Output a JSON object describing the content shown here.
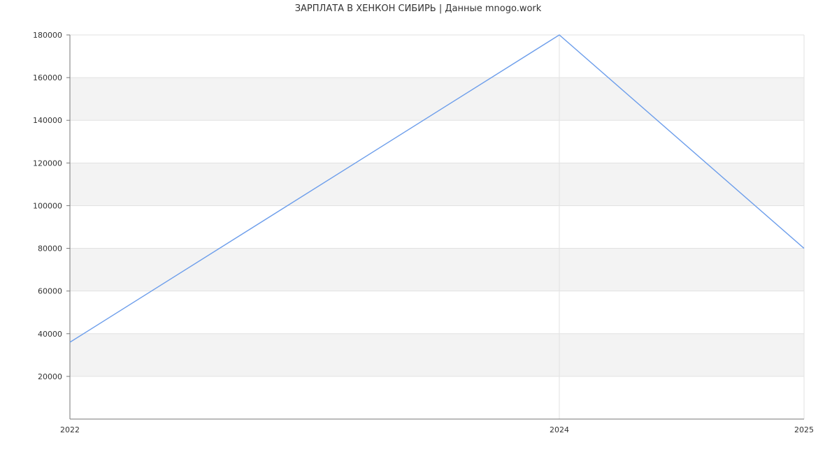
{
  "chart_data": {
    "type": "line",
    "title": "ЗАРПЛАТА В  ХЕНКОН СИБИРЬ  | Данные mnogo.work",
    "xlabel": "",
    "ylabel": "",
    "x": [
      2022,
      2024,
      2025
    ],
    "x_ticks": [
      "2022",
      "2024",
      "2025"
    ],
    "series": [
      {
        "values": [
          36000,
          180000,
          80000
        ],
        "color": "#6d9eeb"
      }
    ],
    "xlim": [
      2022,
      2025
    ],
    "ylim": [
      0,
      180000
    ],
    "y_ticks": [
      20000,
      40000,
      60000,
      80000,
      100000,
      120000,
      140000,
      160000,
      180000
    ],
    "y_tick_labels": [
      "20000",
      "40000",
      "60000",
      "80000",
      "100000",
      "120000",
      "140000",
      "160000",
      "180000"
    ],
    "grid": true,
    "band_color": "#f3f3f3",
    "legend": "none"
  }
}
